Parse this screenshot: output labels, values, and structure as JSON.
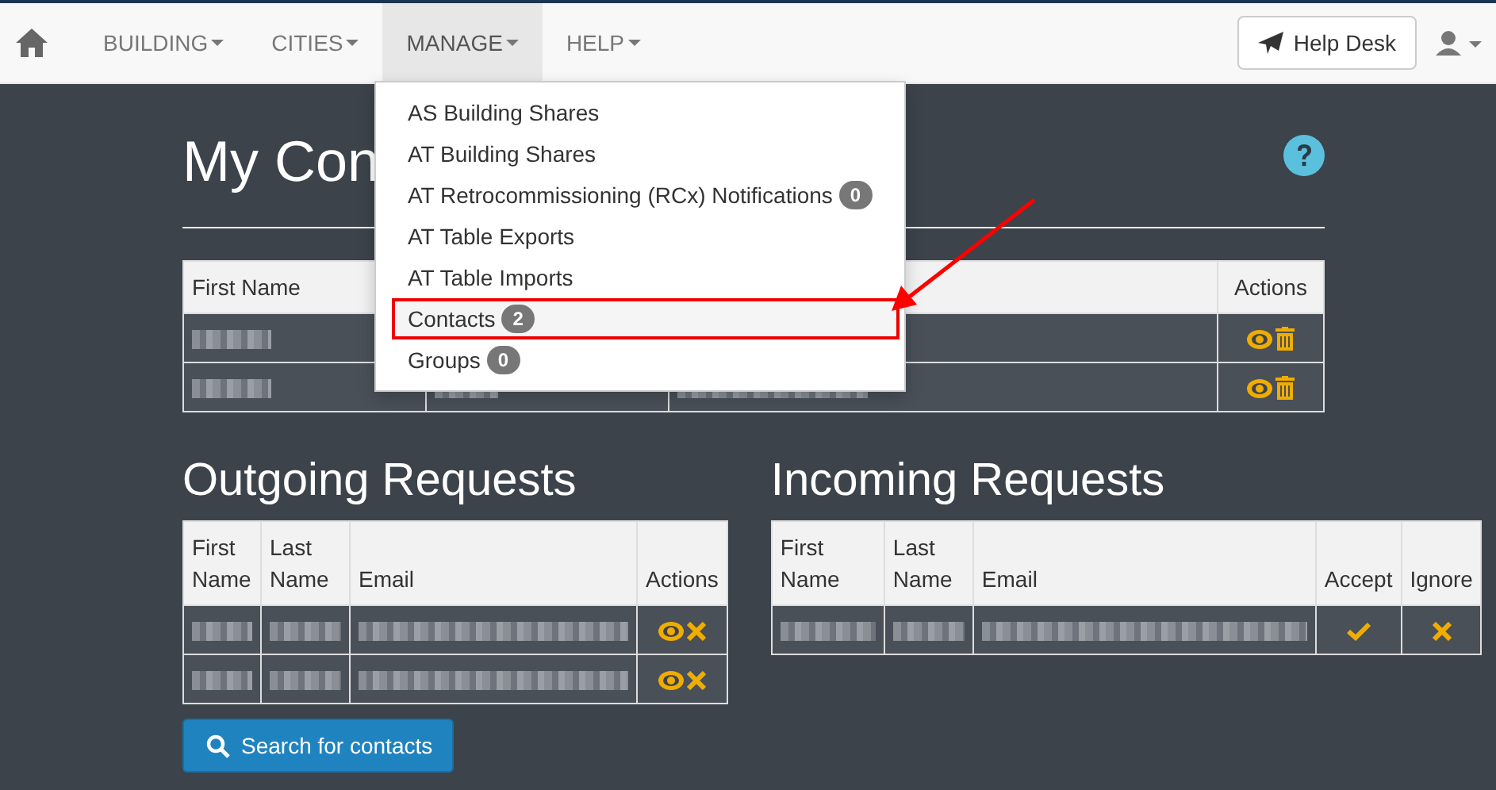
{
  "navbar": {
    "menus": [
      {
        "label": "BUILDING",
        "selected": false
      },
      {
        "label": "CITIES",
        "selected": false
      },
      {
        "label": "MANAGE",
        "selected": true
      },
      {
        "label": "HELP",
        "selected": false
      }
    ],
    "help_desk": "Help Desk"
  },
  "manage_menu": {
    "items": [
      {
        "label": "AS Building Shares",
        "highlighted": false
      },
      {
        "label": "AT Building Shares",
        "highlighted": false
      },
      {
        "label": "AT Retrocommissioning (RCx) Notifications",
        "badge": "0",
        "highlighted": false
      },
      {
        "label": "AT Table Exports",
        "highlighted": false
      },
      {
        "label": "AT Table Imports",
        "highlighted": false
      },
      {
        "label": "Contacts",
        "badge": "2",
        "highlighted": true
      },
      {
        "label": "Groups",
        "badge": "0",
        "highlighted": false
      }
    ]
  },
  "contacts": {
    "title": "My Con",
    "columns": [
      "First Name",
      "",
      "",
      "Actions"
    ],
    "rows": [
      {
        "cells": [
          {
            "kind": "redacted"
          }
        ],
        "actions": [
          {
            "kind": "view"
          },
          {
            "kind": "delete"
          }
        ]
      },
      {
        "cells": [
          {
            "kind": "redacted"
          },
          {
            "kind": "redacted"
          },
          {
            "kind": "redacted"
          }
        ],
        "actions": [
          {
            "kind": "view"
          },
          {
            "kind": "delete"
          }
        ]
      }
    ]
  },
  "outgoing": {
    "title": "Outgoing Requests",
    "columns": [
      "First Name",
      "Last Name",
      "Email",
      "Actions"
    ],
    "rows": [
      {
        "actions": [
          {
            "kind": "view"
          },
          {
            "kind": "cancel"
          }
        ]
      },
      {
        "actions": [
          {
            "kind": "view"
          },
          {
            "kind": "cancel"
          }
        ]
      }
    ]
  },
  "incoming": {
    "title": "Incoming Requests",
    "columns": [
      "First Name",
      "Last Name",
      "Email",
      "Accept",
      "Ignore"
    ],
    "rows": [
      {
        "actions": [
          {
            "kind": "accept"
          },
          {
            "kind": "ignore"
          }
        ]
      }
    ]
  },
  "search_button": "Search for contacts"
}
